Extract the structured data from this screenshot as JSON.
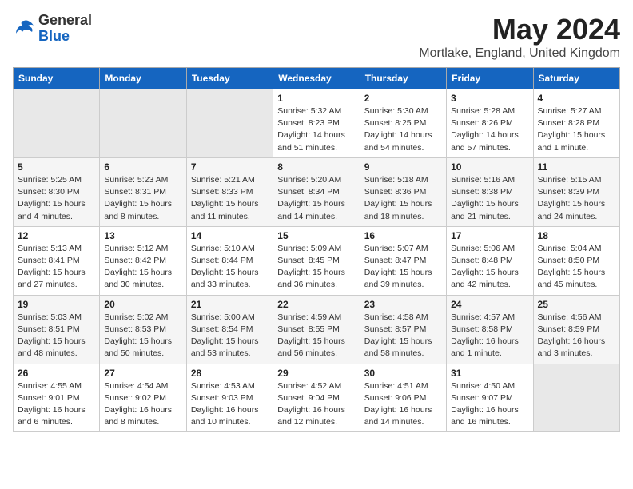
{
  "header": {
    "logo_general": "General",
    "logo_blue": "Blue",
    "month_title": "May 2024",
    "location": "Mortlake, England, United Kingdom"
  },
  "weekdays": [
    "Sunday",
    "Monday",
    "Tuesday",
    "Wednesday",
    "Thursday",
    "Friday",
    "Saturday"
  ],
  "weeks": [
    [
      {
        "day": "",
        "info": ""
      },
      {
        "day": "",
        "info": ""
      },
      {
        "day": "",
        "info": ""
      },
      {
        "day": "1",
        "info": "Sunrise: 5:32 AM\nSunset: 8:23 PM\nDaylight: 14 hours\nand 51 minutes."
      },
      {
        "day": "2",
        "info": "Sunrise: 5:30 AM\nSunset: 8:25 PM\nDaylight: 14 hours\nand 54 minutes."
      },
      {
        "day": "3",
        "info": "Sunrise: 5:28 AM\nSunset: 8:26 PM\nDaylight: 14 hours\nand 57 minutes."
      },
      {
        "day": "4",
        "info": "Sunrise: 5:27 AM\nSunset: 8:28 PM\nDaylight: 15 hours\nand 1 minute."
      }
    ],
    [
      {
        "day": "5",
        "info": "Sunrise: 5:25 AM\nSunset: 8:30 PM\nDaylight: 15 hours\nand 4 minutes."
      },
      {
        "day": "6",
        "info": "Sunrise: 5:23 AM\nSunset: 8:31 PM\nDaylight: 15 hours\nand 8 minutes."
      },
      {
        "day": "7",
        "info": "Sunrise: 5:21 AM\nSunset: 8:33 PM\nDaylight: 15 hours\nand 11 minutes."
      },
      {
        "day": "8",
        "info": "Sunrise: 5:20 AM\nSunset: 8:34 PM\nDaylight: 15 hours\nand 14 minutes."
      },
      {
        "day": "9",
        "info": "Sunrise: 5:18 AM\nSunset: 8:36 PM\nDaylight: 15 hours\nand 18 minutes."
      },
      {
        "day": "10",
        "info": "Sunrise: 5:16 AM\nSunset: 8:38 PM\nDaylight: 15 hours\nand 21 minutes."
      },
      {
        "day": "11",
        "info": "Sunrise: 5:15 AM\nSunset: 8:39 PM\nDaylight: 15 hours\nand 24 minutes."
      }
    ],
    [
      {
        "day": "12",
        "info": "Sunrise: 5:13 AM\nSunset: 8:41 PM\nDaylight: 15 hours\nand 27 minutes."
      },
      {
        "day": "13",
        "info": "Sunrise: 5:12 AM\nSunset: 8:42 PM\nDaylight: 15 hours\nand 30 minutes."
      },
      {
        "day": "14",
        "info": "Sunrise: 5:10 AM\nSunset: 8:44 PM\nDaylight: 15 hours\nand 33 minutes."
      },
      {
        "day": "15",
        "info": "Sunrise: 5:09 AM\nSunset: 8:45 PM\nDaylight: 15 hours\nand 36 minutes."
      },
      {
        "day": "16",
        "info": "Sunrise: 5:07 AM\nSunset: 8:47 PM\nDaylight: 15 hours\nand 39 minutes."
      },
      {
        "day": "17",
        "info": "Sunrise: 5:06 AM\nSunset: 8:48 PM\nDaylight: 15 hours\nand 42 minutes."
      },
      {
        "day": "18",
        "info": "Sunrise: 5:04 AM\nSunset: 8:50 PM\nDaylight: 15 hours\nand 45 minutes."
      }
    ],
    [
      {
        "day": "19",
        "info": "Sunrise: 5:03 AM\nSunset: 8:51 PM\nDaylight: 15 hours\nand 48 minutes."
      },
      {
        "day": "20",
        "info": "Sunrise: 5:02 AM\nSunset: 8:53 PM\nDaylight: 15 hours\nand 50 minutes."
      },
      {
        "day": "21",
        "info": "Sunrise: 5:00 AM\nSunset: 8:54 PM\nDaylight: 15 hours\nand 53 minutes."
      },
      {
        "day": "22",
        "info": "Sunrise: 4:59 AM\nSunset: 8:55 PM\nDaylight: 15 hours\nand 56 minutes."
      },
      {
        "day": "23",
        "info": "Sunrise: 4:58 AM\nSunset: 8:57 PM\nDaylight: 15 hours\nand 58 minutes."
      },
      {
        "day": "24",
        "info": "Sunrise: 4:57 AM\nSunset: 8:58 PM\nDaylight: 16 hours\nand 1 minute."
      },
      {
        "day": "25",
        "info": "Sunrise: 4:56 AM\nSunset: 8:59 PM\nDaylight: 16 hours\nand 3 minutes."
      }
    ],
    [
      {
        "day": "26",
        "info": "Sunrise: 4:55 AM\nSunset: 9:01 PM\nDaylight: 16 hours\nand 6 minutes."
      },
      {
        "day": "27",
        "info": "Sunrise: 4:54 AM\nSunset: 9:02 PM\nDaylight: 16 hours\nand 8 minutes."
      },
      {
        "day": "28",
        "info": "Sunrise: 4:53 AM\nSunset: 9:03 PM\nDaylight: 16 hours\nand 10 minutes."
      },
      {
        "day": "29",
        "info": "Sunrise: 4:52 AM\nSunset: 9:04 PM\nDaylight: 16 hours\nand 12 minutes."
      },
      {
        "day": "30",
        "info": "Sunrise: 4:51 AM\nSunset: 9:06 PM\nDaylight: 16 hours\nand 14 minutes."
      },
      {
        "day": "31",
        "info": "Sunrise: 4:50 AM\nSunset: 9:07 PM\nDaylight: 16 hours\nand 16 minutes."
      },
      {
        "day": "",
        "info": ""
      }
    ]
  ]
}
